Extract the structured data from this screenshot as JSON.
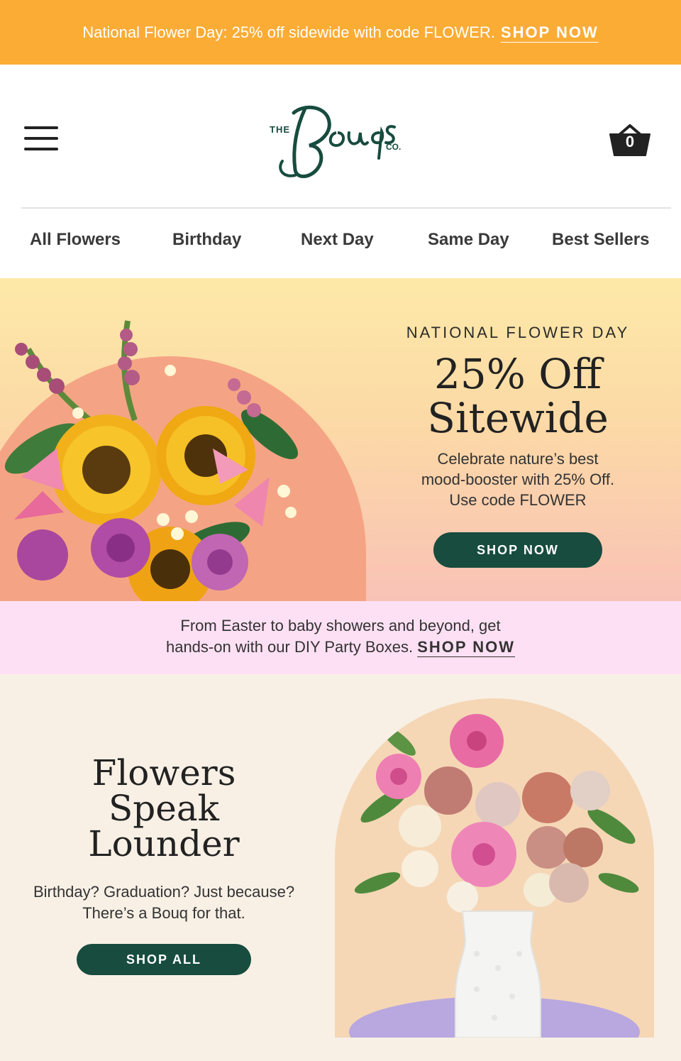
{
  "announcement": {
    "text": "National Flower Day: 25% off sidewide with code FLOWER.",
    "cta": "SHOP NOW"
  },
  "header": {
    "logo_text": "The Bouqs Co.",
    "cart_count": "0"
  },
  "nav": {
    "items": [
      "All Flowers",
      "Birthday",
      "Next Day",
      "Same Day",
      "Best Sellers"
    ]
  },
  "hero": {
    "eyebrow": "NATIONAL FLOWER DAY",
    "title_line1": "25% Off",
    "title_line2": "Sitewide",
    "text_line1": "Celebrate nature’s best",
    "text_line2": "mood-booster with 25% Off.",
    "text_line3": "Use code FLOWER",
    "cta": "SHOP NOW"
  },
  "promo": {
    "line1": "From Easter to baby showers and beyond, get",
    "line2": "hands-on with our DIY Party Boxes.",
    "cta": "SHOP NOW"
  },
  "section2": {
    "title_line1": "Flowers",
    "title_line2": "Speak",
    "title_line3": "Lounder",
    "text_line1": "Birthday? Graduation? Just because?",
    "text_line2": "There’s a Bouq for that.",
    "cta": "SHOP ALL"
  },
  "colors": {
    "announcement_bg": "#fbac35",
    "brand_green": "#174c3f",
    "promo_bg": "#fde0f4",
    "section_bg": "#f8f0e5"
  },
  "icons": [
    "menu-icon",
    "cart-icon"
  ]
}
